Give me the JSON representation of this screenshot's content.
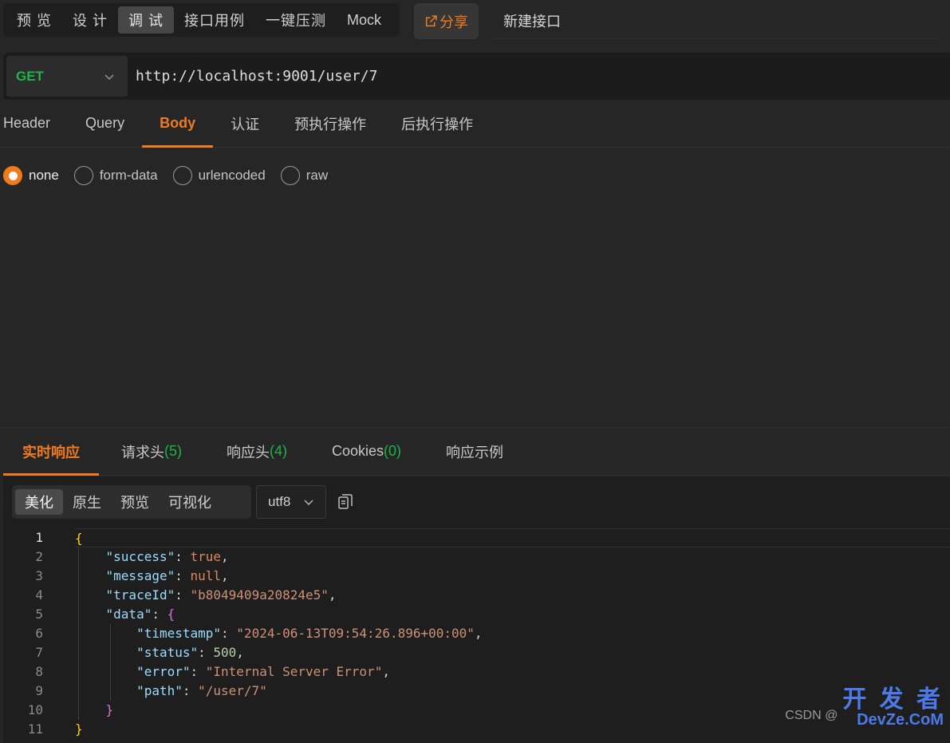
{
  "mode_tabs": [
    {
      "label": "预 览",
      "active": false
    },
    {
      "label": "设 计",
      "active": false
    },
    {
      "label": "调 试",
      "active": true
    },
    {
      "label": "接口用例",
      "active": false
    },
    {
      "label": "一键压测",
      "active": false
    },
    {
      "label": "Mock",
      "active": false
    }
  ],
  "share_label": "分享",
  "new_api_label": "新建接口",
  "request": {
    "method": "GET",
    "url": "http://localhost:9001/user/7"
  },
  "request_tabs": [
    "Header",
    "Query",
    "Body",
    "认证",
    "预执行操作",
    "后执行操作"
  ],
  "body_types": [
    {
      "label": "none",
      "checked": true
    },
    {
      "label": "form-data",
      "checked": false
    },
    {
      "label": "urlencoded",
      "checked": false
    },
    {
      "label": "raw",
      "checked": false
    }
  ],
  "response_tabs": [
    {
      "label": "实时响应",
      "count": ""
    },
    {
      "label": "请求头",
      "count": "(5)"
    },
    {
      "label": "响应头",
      "count": "(4)"
    },
    {
      "label": "Cookies",
      "count": "(0)"
    },
    {
      "label": "响应示例",
      "count": ""
    }
  ],
  "view_tabs": [
    "美化",
    "原生",
    "预览",
    "可视化"
  ],
  "encoding": "utf8",
  "code": {
    "line_numbers": [
      "1",
      "2",
      "3",
      "4",
      "5",
      "6",
      "7",
      "8",
      "9",
      "10",
      "11"
    ],
    "success_key": "\"success\"",
    "success_val": "true",
    "message_key": "\"message\"",
    "message_val": "null",
    "traceId_key": "\"traceId\"",
    "traceId_val": "\"b8049409a20824e5\"",
    "data_key": "\"data\"",
    "timestamp_key": "\"timestamp\"",
    "timestamp_val": "\"2024-06-13T09:54:26.896+00:00\"",
    "status_key": "\"status\"",
    "status_val": "500",
    "error_key": "\"error\"",
    "error_val": "\"Internal Server Error\"",
    "path_key": "\"path\"",
    "path_val": "\"/user/7\""
  },
  "watermark": {
    "csdn": "CSDN @",
    "brand_cn": "开 发 者",
    "brand_en": "DevZe.CoM"
  },
  "colors": {
    "accent": "#f07b1d",
    "method_get": "#1fb34a",
    "count": "#1fb34a"
  },
  "icons": {
    "share": "share-icon",
    "method_dropdown": "chevron-down-icon",
    "encoding_dropdown": "chevron-down-icon",
    "copy": "copy-icon"
  }
}
